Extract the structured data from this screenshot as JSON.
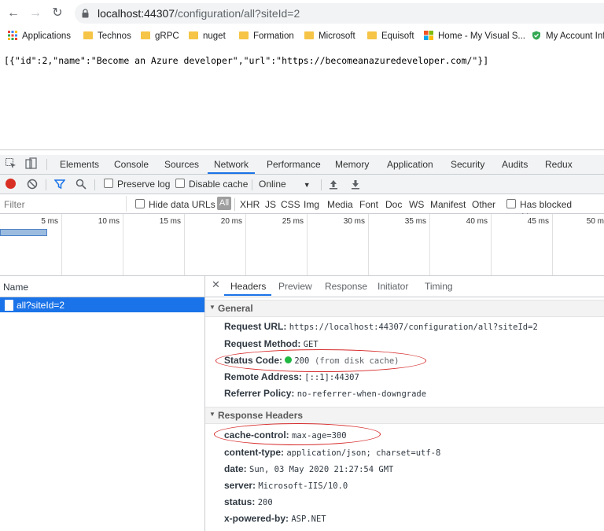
{
  "browser": {
    "url_host": "localhost:44307",
    "url_path": "/configuration/all?siteId=2",
    "bookmarks": [
      {
        "label": "Applications",
        "icon": "apps-grid-icon"
      },
      {
        "label": "Technos",
        "icon": "folder-icon"
      },
      {
        "label": "gRPC",
        "icon": "folder-icon"
      },
      {
        "label": "nuget",
        "icon": "folder-icon"
      },
      {
        "label": "Formation",
        "icon": "folder-icon"
      },
      {
        "label": "Microsoft",
        "icon": "folder-icon"
      },
      {
        "label": "Equisoft",
        "icon": "folder-icon"
      },
      {
        "label": "Home - My Visual S...",
        "icon": "windows-logo-icon"
      },
      {
        "label": "My Account Info",
        "icon": "shield-icon"
      }
    ]
  },
  "page": {
    "json_output": "[{\"id\":2,\"name\":\"Become an Azure developer\",\"url\":\"https://becomeanazuredeveloper.com/\"}]"
  },
  "devtools": {
    "tabs": [
      "Elements",
      "Console",
      "Sources",
      "Network",
      "Performance",
      "Memory",
      "Application",
      "Security",
      "Audits",
      "Redux"
    ],
    "active_tab": "Network",
    "toolbar": {
      "preserve_log": "Preserve log",
      "disable_cache": "Disable cache",
      "throttle": "Online"
    },
    "filter": {
      "placeholder": "Filter",
      "hide_data_urls": "Hide data URLs",
      "types": [
        "All",
        "XHR",
        "JS",
        "CSS",
        "Img",
        "Media",
        "Font",
        "Doc",
        "WS",
        "Manifest",
        "Other"
      ],
      "has_blocked_cookies": "Has blocked cookies"
    },
    "timeline_ticks": [
      "5 ms",
      "10 ms",
      "15 ms",
      "20 ms",
      "25 ms",
      "30 ms",
      "35 ms",
      "40 ms",
      "45 ms",
      "50 m"
    ],
    "name_column_header": "Name",
    "requests": [
      {
        "name": "all?siteId=2",
        "selected": true
      }
    ],
    "detail_tabs": [
      "Headers",
      "Preview",
      "Response",
      "Initiator",
      "Timing"
    ],
    "active_detail_tab": "Headers",
    "general": {
      "title": "General",
      "request_url_label": "Request URL:",
      "request_url": "https://localhost:44307/configuration/all?siteId=2",
      "request_method_label": "Request Method:",
      "request_method": "GET",
      "status_code_label": "Status Code:",
      "status_code": "200",
      "status_note": "(from disk cache)",
      "remote_address_label": "Remote Address:",
      "remote_address": "[::1]:44307",
      "referrer_policy_label": "Referrer Policy:",
      "referrer_policy": "no-referrer-when-downgrade"
    },
    "response_headers": {
      "title": "Response Headers",
      "items": [
        {
          "key": "cache-control:",
          "value": "max-age=300"
        },
        {
          "key": "content-type:",
          "value": "application/json; charset=utf-8"
        },
        {
          "key": "date:",
          "value": "Sun, 03 May 2020 21:27:54 GMT"
        },
        {
          "key": "server:",
          "value": "Microsoft-IIS/10.0"
        },
        {
          "key": "status:",
          "value": "200"
        },
        {
          "key": "x-powered-by:",
          "value": "ASP.NET"
        }
      ]
    },
    "colors": {
      "accent": "#1a73e8",
      "status_ok": "#1fb842",
      "annotation": "#d62828"
    }
  }
}
